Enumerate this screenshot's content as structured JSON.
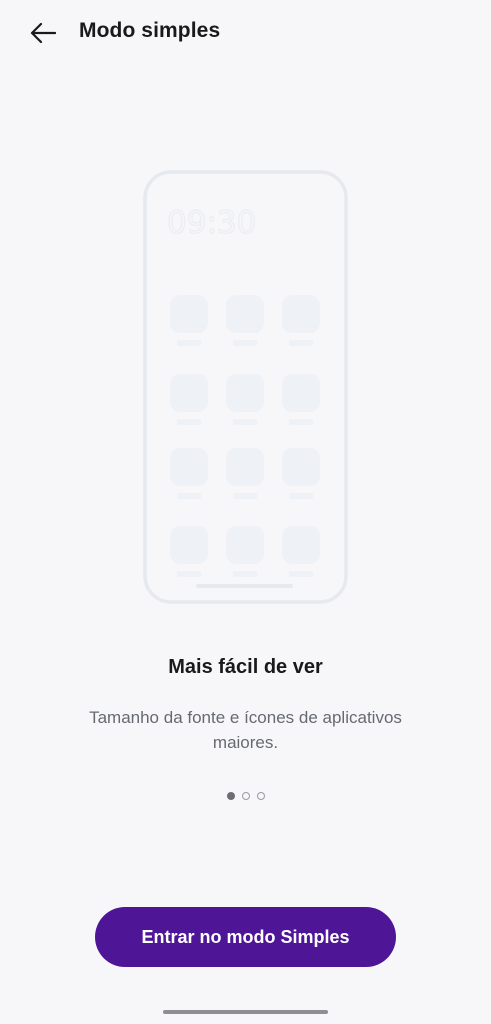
{
  "header": {
    "title": "Modo simples",
    "back_icon": "arrow-left-icon"
  },
  "illustration": {
    "clock": "09:30",
    "app_rows": 4,
    "app_cols": 3
  },
  "slide": {
    "title": "Mais fácil de ver",
    "description": "Tamanho da fonte e ícones de aplicativos maiores."
  },
  "pager": {
    "total": 3,
    "active_index": 0
  },
  "action": {
    "label": "Entrar no modo Simples"
  },
  "colors": {
    "primary": "#4e1596",
    "background": "#f7f7f9",
    "illustration_outline": "#e6e9ed",
    "illustration_tile": "#eef1f6"
  }
}
